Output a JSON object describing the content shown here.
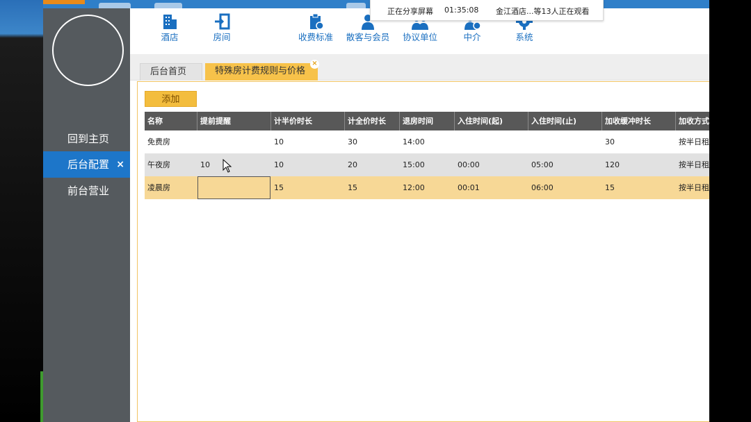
{
  "share_banner": {
    "status": "正在分享屏幕",
    "time": "01:35:08",
    "viewers": "金江酒店...等13人正在观看"
  },
  "sidebar": {
    "items": [
      {
        "label": "回到主页",
        "active": false
      },
      {
        "label": "后台配置",
        "active": true,
        "close": "×"
      },
      {
        "label": "前台营业",
        "active": false
      }
    ]
  },
  "toolbar": {
    "items": [
      {
        "label": "酒店",
        "icon": "building-icon"
      },
      {
        "label": "房间",
        "icon": "door-enter-icon"
      },
      {
        "label": "收费标准",
        "icon": "clipboard-icon"
      },
      {
        "label": "散客与会员",
        "icon": "person-icon"
      },
      {
        "label": "协议单位",
        "icon": "group-icon"
      },
      {
        "label": "中介",
        "icon": "agent-icon"
      },
      {
        "label": "系统",
        "icon": "gear-icon"
      }
    ]
  },
  "tabs": {
    "home": "后台首页",
    "current": "特殊房计费规则与价格",
    "close": "×"
  },
  "actions": {
    "add_label": "添加"
  },
  "table": {
    "columns": [
      "名称",
      "提前提醒",
      "计半价时长",
      "计全价时长",
      "退房时间",
      "入住时间(起)",
      "入住时间(止)",
      "加收缓冲时长",
      "加收方式"
    ],
    "rows": [
      [
        "免费房",
        "",
        "10",
        "30",
        "14:00",
        "",
        "",
        "30",
        "按半日租"
      ],
      [
        "午夜房",
        "10",
        "10",
        "20",
        "15:00",
        "00:00",
        "05:00",
        "120",
        "按半日租"
      ],
      [
        "凌晨房",
        "",
        "15",
        "15",
        "12:00",
        "00:01",
        "06:00",
        "15",
        "按半日租"
      ]
    ]
  },
  "colors": {
    "accent_blue": "#1d76c9",
    "sidebar_bg": "#555a5e",
    "tab_active": "#f7c24a",
    "selected_row": "#f7d896"
  }
}
